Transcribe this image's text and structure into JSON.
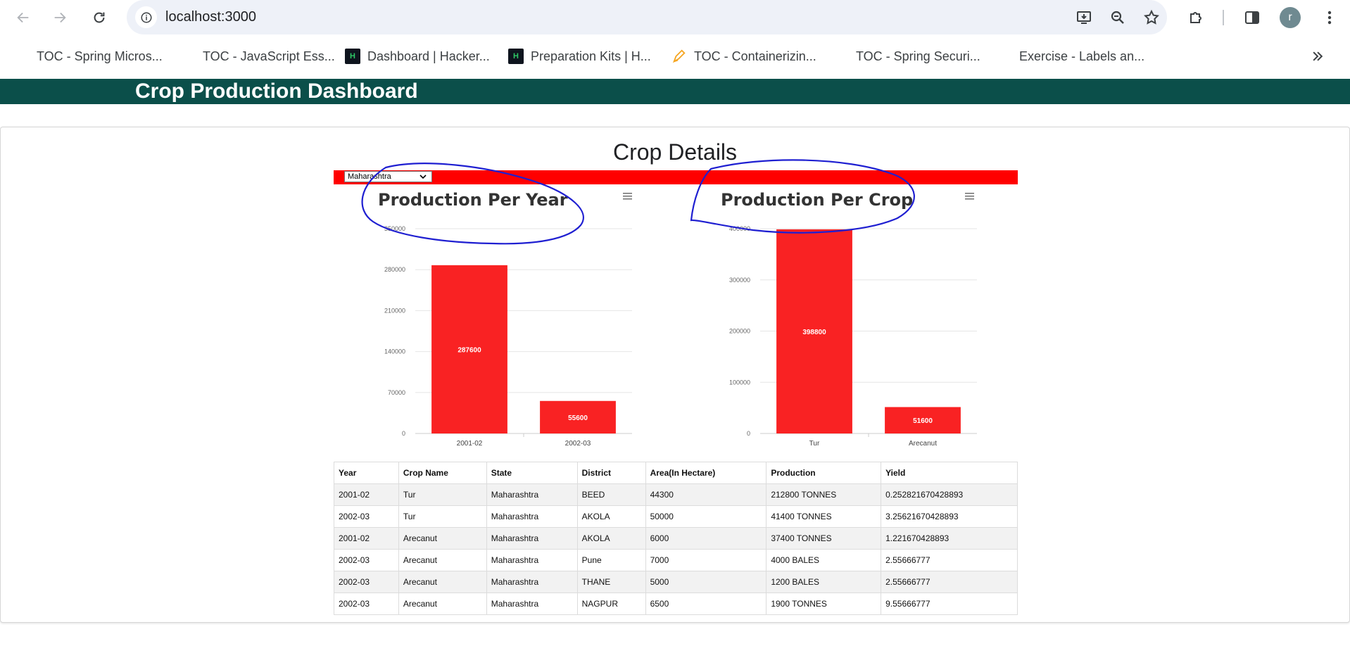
{
  "browser": {
    "url": "localhost:3000",
    "profile_initial": "r",
    "bookmarks": [
      {
        "label": "TOC - Spring Micros...",
        "icon": "blank-page-icon"
      },
      {
        "label": "TOC - JavaScript Ess...",
        "icon": "blank-page-icon"
      },
      {
        "label": "Dashboard | Hacker...",
        "icon": "hackerrank-icon"
      },
      {
        "label": "Preparation Kits | H...",
        "icon": "hackerrank-icon"
      },
      {
        "label": "TOC - Containerizin...",
        "icon": "pen-icon"
      },
      {
        "label": "TOC - Spring Securi...",
        "icon": "blank-page-icon"
      },
      {
        "label": "Exercise - Labels an...",
        "icon": "blank-page-icon"
      }
    ],
    "hackerrank_badge": "H"
  },
  "app": {
    "title": "Crop Production Dashboard",
    "header_color": "#0b4f4a",
    "accent_color": "#ff0000",
    "section_title": "Crop Details",
    "state_select": {
      "value": "Maharashtra"
    }
  },
  "chart_data": [
    {
      "type": "bar",
      "title": "Production Per Year",
      "categories": [
        "2001-02",
        "2002-03"
      ],
      "values": [
        287600,
        55600
      ],
      "ylim": [
        0,
        350000
      ],
      "yticks": [
        "0",
        "70000",
        "140000",
        "210000",
        "280000",
        "350000"
      ],
      "ytick_values": [
        0,
        70000,
        140000,
        210000,
        280000,
        350000
      ],
      "data_labels": [
        "287600",
        "55600"
      ],
      "color": "#f92223",
      "grid": true
    },
    {
      "type": "bar",
      "title": "Production Per Crop",
      "categories": [
        "Tur",
        "Arecanut"
      ],
      "values": [
        398800,
        51600
      ],
      "ylim": [
        0,
        400000
      ],
      "yticks": [
        "0",
        "100000",
        "200000",
        "300000",
        "400000"
      ],
      "ytick_values": [
        0,
        100000,
        200000,
        300000,
        400000
      ],
      "data_labels": [
        "398800",
        "51600"
      ],
      "color": "#f92223",
      "grid": true
    }
  ],
  "table": {
    "headers": [
      "Year",
      "Crop Name",
      "State",
      "District",
      "Area(In Hectare)",
      "Production",
      "Yield"
    ],
    "rows": [
      [
        "2001-02",
        "Tur",
        "Maharashtra",
        "BEED",
        "44300",
        "212800 TONNES",
        "0.252821670428893"
      ],
      [
        "2002-03",
        "Tur",
        "Maharashtra",
        "AKOLA",
        "50000",
        "41400 TONNES",
        "3.25621670428893"
      ],
      [
        "2001-02",
        "Arecanut",
        "Maharashtra",
        "AKOLA",
        "6000",
        "37400 TONNES",
        "1.221670428893"
      ],
      [
        "2002-03",
        "Arecanut",
        "Maharashtra",
        "Pune",
        "7000",
        "4000 BALES",
        "2.55666777"
      ],
      [
        "2002-03",
        "Arecanut",
        "Maharashtra",
        "THANE",
        "5000",
        "1200 BALES",
        "2.55666777"
      ],
      [
        "2002-03",
        "Arecanut",
        "Maharashtra",
        "NAGPUR",
        "6500",
        "1900 TONNES",
        "9.55666777"
      ]
    ]
  }
}
